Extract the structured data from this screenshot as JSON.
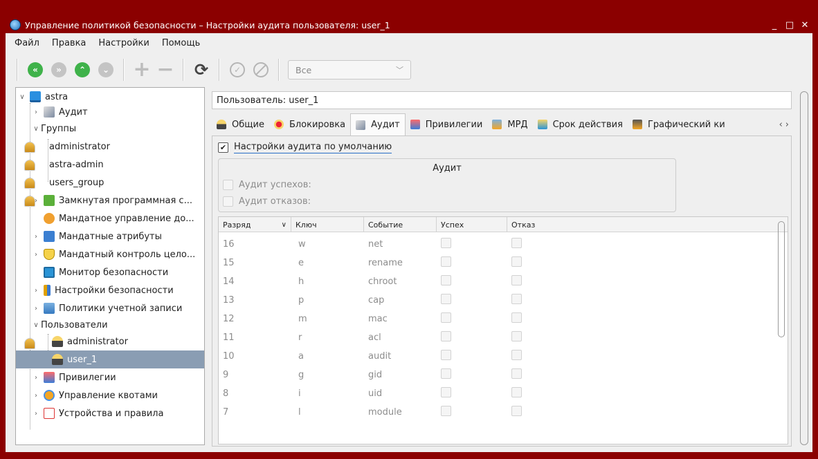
{
  "window": {
    "title": "Управление политикой безопасности – Настройки аудита пользователя: user_1",
    "controls": [
      "_",
      "□",
      "✕"
    ]
  },
  "menubar": [
    "Файл",
    "Правка",
    "Настройки",
    "Помощь"
  ],
  "toolbar": {
    "filter": "Все"
  },
  "tree": {
    "root": "astra",
    "items": [
      {
        "label": "Аудит"
      },
      {
        "label": "Группы"
      },
      {
        "label": "administrator"
      },
      {
        "label": "astra-admin"
      },
      {
        "label": "users_group"
      },
      {
        "label": "Замкнутая программная с..."
      },
      {
        "label": "Мандатное управление до..."
      },
      {
        "label": "Мандатные атрибуты"
      },
      {
        "label": "Мандатный контроль цело..."
      },
      {
        "label": "Монитор безопасности"
      },
      {
        "label": "Настройки безопасности"
      },
      {
        "label": "Политики учетной записи"
      },
      {
        "label": "Пользователи"
      },
      {
        "label": "administrator"
      },
      {
        "label": "user_1"
      },
      {
        "label": "Привилегии"
      },
      {
        "label": "Управление квотами"
      },
      {
        "label": "Устройства и правила"
      }
    ]
  },
  "user_field": "Пользователь: user_1",
  "tabs": [
    "Общие",
    "Блокировка",
    "Аудит",
    "Привилегии",
    "МРД",
    "Срок действия",
    "Графический ки"
  ],
  "audit": {
    "default_label": "Настройки аудита по умолчанию",
    "group_title": "Аудит",
    "success_label": "Аудит успехов:",
    "failure_label": "Аудит отказов:"
  },
  "table": {
    "headers": [
      "Разряд",
      "Ключ",
      "Событие",
      "Успех",
      "Отказ"
    ],
    "rows": [
      [
        "16",
        "w",
        "net"
      ],
      [
        "15",
        "e",
        "rename"
      ],
      [
        "14",
        "h",
        "chroot"
      ],
      [
        "13",
        "p",
        "cap"
      ],
      [
        "12",
        "m",
        "mac"
      ],
      [
        "11",
        "r",
        "acl"
      ],
      [
        "10",
        "a",
        "audit"
      ],
      [
        "9",
        "g",
        "gid"
      ],
      [
        "8",
        "i",
        "uid"
      ],
      [
        "7",
        "l",
        "module"
      ]
    ]
  }
}
